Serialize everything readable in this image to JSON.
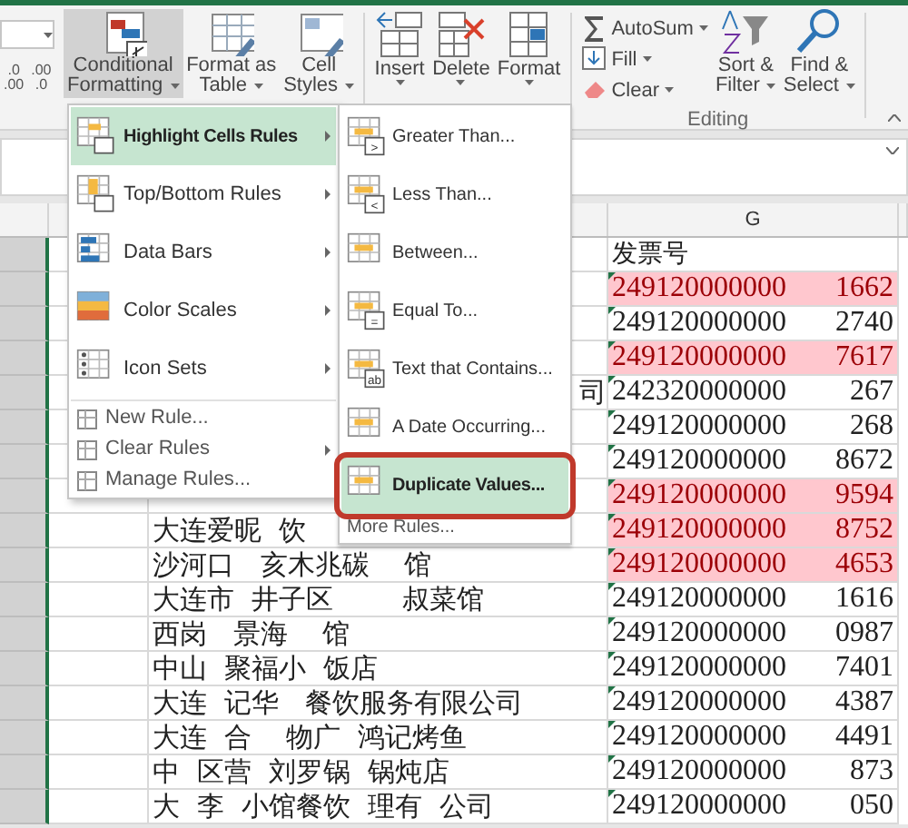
{
  "ribbon": {
    "decimal_buttons": [
      {
        "top": ".0",
        "bottom": ".00"
      },
      {
        "top": ".00",
        "bottom": ".0"
      }
    ],
    "styles_group": [
      {
        "lines": [
          "Conditional",
          "Formatting"
        ],
        "selected": true
      },
      {
        "lines": [
          "Format as",
          "Table"
        ],
        "selected": false
      },
      {
        "lines": [
          "Cell",
          "Styles"
        ],
        "selected": false
      }
    ],
    "cells_group": [
      {
        "label": "Insert"
      },
      {
        "label": "Delete"
      },
      {
        "label": "Format"
      }
    ],
    "editing": {
      "small_buttons": [
        {
          "label": "AutoSum",
          "kind": "sum"
        },
        {
          "label": "Fill",
          "kind": "fill"
        },
        {
          "label": "Clear",
          "kind": "clear"
        }
      ],
      "big_buttons": [
        {
          "lines": [
            "Sort &",
            "Filter"
          ],
          "kind": "sort"
        },
        {
          "lines": [
            "Find &",
            "Select"
          ],
          "kind": "find"
        }
      ],
      "label": "Editing"
    }
  },
  "sheet": {
    "column_header": "G",
    "header_cell": "发票号",
    "rows": [
      {
        "prefix": "249120000000",
        "suffix": "1662",
        "duplicate": true
      },
      {
        "prefix": "249120000000",
        "suffix": "2740",
        "duplicate": false
      },
      {
        "prefix": "249120000000",
        "suffix": "7617",
        "duplicate": true
      },
      {
        "prefix": "242320000000",
        "suffix": "267",
        "duplicate": false,
        "name_tail": "司"
      },
      {
        "prefix": "249120000000",
        "suffix": "268",
        "duplicate": false
      },
      {
        "prefix": "249120000000",
        "suffix": "8672",
        "duplicate": false
      },
      {
        "prefix": "249120000000",
        "suffix": "9594",
        "duplicate": true
      },
      {
        "prefix": "249120000000",
        "suffix": "8752",
        "duplicate": true,
        "name": "大连爱昵  饮"
      },
      {
        "prefix": "249120000000",
        "suffix": "4653",
        "duplicate": true,
        "name": "沙河口   亥木兆碳    馆"
      },
      {
        "prefix": "249120000000",
        "suffix": "1616",
        "duplicate": false,
        "name": "大连市  井子区        叔菜馆"
      },
      {
        "prefix": "249120000000",
        "suffix": "0987",
        "duplicate": false,
        "name": "西岗   景海    馆"
      },
      {
        "prefix": "249120000000",
        "suffix": "7401",
        "duplicate": false,
        "name": "中山  聚福小  饭店"
      },
      {
        "prefix": "249120000000",
        "suffix": "4387",
        "duplicate": false,
        "name": "大连  记华   餐饮服务有限公司"
      },
      {
        "prefix": "249120000000",
        "suffix": "4491",
        "duplicate": false,
        "name": "大连  合    物广  鸿记烤鱼"
      },
      {
        "prefix": "249120000000",
        "suffix": "873",
        "duplicate": false,
        "name": "中  区营  刘罗锅  锅炖店"
      },
      {
        "prefix": "249120000000",
        "suffix": "050",
        "duplicate": false,
        "name": "大  李  小馆餐饮  理有  公司"
      }
    ]
  },
  "menu": {
    "items": [
      {
        "label": "Highlight Cells Rules",
        "kind": "large",
        "has_submenu": true,
        "selected": true
      },
      {
        "label": "Top/Bottom Rules",
        "kind": "large",
        "has_submenu": true,
        "selected": false
      },
      {
        "label": "Data Bars",
        "kind": "large",
        "has_submenu": true,
        "selected": false
      },
      {
        "label": "Color Scales",
        "kind": "large",
        "has_submenu": true,
        "selected": false
      },
      {
        "label": "Icon Sets",
        "kind": "large",
        "has_submenu": true,
        "selected": false
      },
      {
        "label": "New Rule...",
        "kind": "small",
        "has_submenu": false,
        "selected": false
      },
      {
        "label": "Clear Rules",
        "kind": "small",
        "has_submenu": true,
        "selected": false
      },
      {
        "label": "Manage Rules...",
        "kind": "small",
        "has_submenu": false,
        "selected": false
      }
    ]
  },
  "submenu": {
    "items": [
      {
        "label": "Greater Than...",
        "kind": "large",
        "selected": false,
        "annotated": false,
        "sign": ">"
      },
      {
        "label": "Less Than...",
        "kind": "large",
        "selected": false,
        "annotated": false,
        "sign": "<"
      },
      {
        "label": "Between...",
        "kind": "large",
        "selected": false,
        "annotated": false
      },
      {
        "label": "Equal To...",
        "kind": "large",
        "selected": false,
        "annotated": false,
        "sign": "="
      },
      {
        "label": "Text that Contains...",
        "kind": "large",
        "selected": false,
        "annotated": false,
        "sign": "ab"
      },
      {
        "label": "A Date Occurring...",
        "kind": "large",
        "selected": false,
        "annotated": false
      },
      {
        "label": "Duplicate Values...",
        "kind": "large",
        "selected": true,
        "annotated": true
      },
      {
        "label": "More Rules...",
        "kind": "small",
        "selected": false,
        "annotated": false
      }
    ]
  }
}
